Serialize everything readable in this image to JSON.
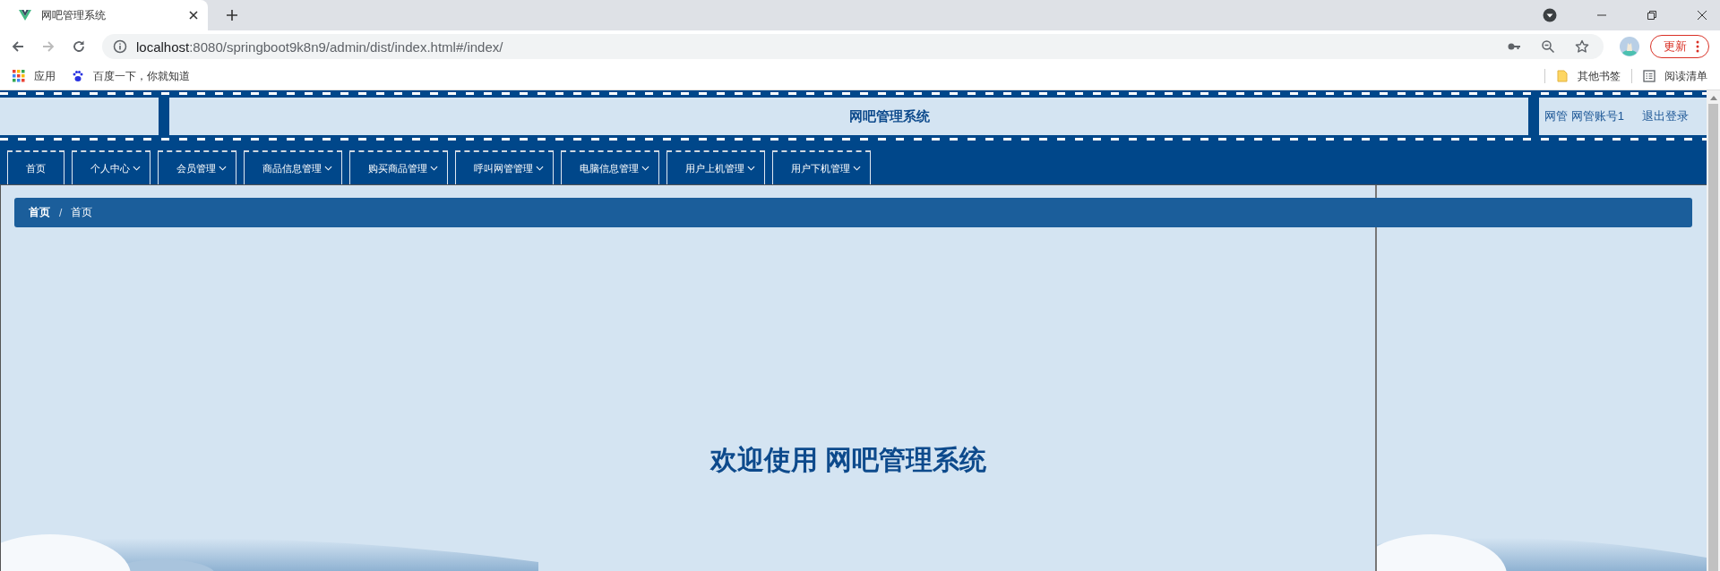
{
  "browser": {
    "tab_title": "网吧管理系统",
    "url_host": "localhost",
    "url_rest": ":8080/springboot9k8n9/admin/dist/index.html#/index/",
    "update_button": "更新",
    "bookmarks": [
      {
        "label": "应用",
        "kind": "apps"
      },
      {
        "label": "百度一下，你就知道",
        "kind": "paw"
      }
    ],
    "other_bookmarks": "其他书签",
    "reading_list": "阅读清单"
  },
  "header": {
    "title": "网吧管理系统",
    "user": "网管 网管账号1",
    "logout": "退出登录"
  },
  "nav": [
    {
      "label": "首页",
      "has_menu": false
    },
    {
      "label": "个人中心",
      "has_menu": true
    },
    {
      "label": "会员管理",
      "has_menu": true
    },
    {
      "label": "商品信息管理",
      "has_menu": true
    },
    {
      "label": "购买商品管理",
      "has_menu": true
    },
    {
      "label": "呼叫网管管理",
      "has_menu": true
    },
    {
      "label": "电脑信息管理",
      "has_menu": true
    },
    {
      "label": "用户上机管理",
      "has_menu": true
    },
    {
      "label": "用户下机管理",
      "has_menu": true
    }
  ],
  "breadcrumb": {
    "separator": "/",
    "items": [
      {
        "label": "首页",
        "current": false
      },
      {
        "label": "首页",
        "current": true
      }
    ]
  },
  "welcome": "欢迎使用 网吧管理系统"
}
